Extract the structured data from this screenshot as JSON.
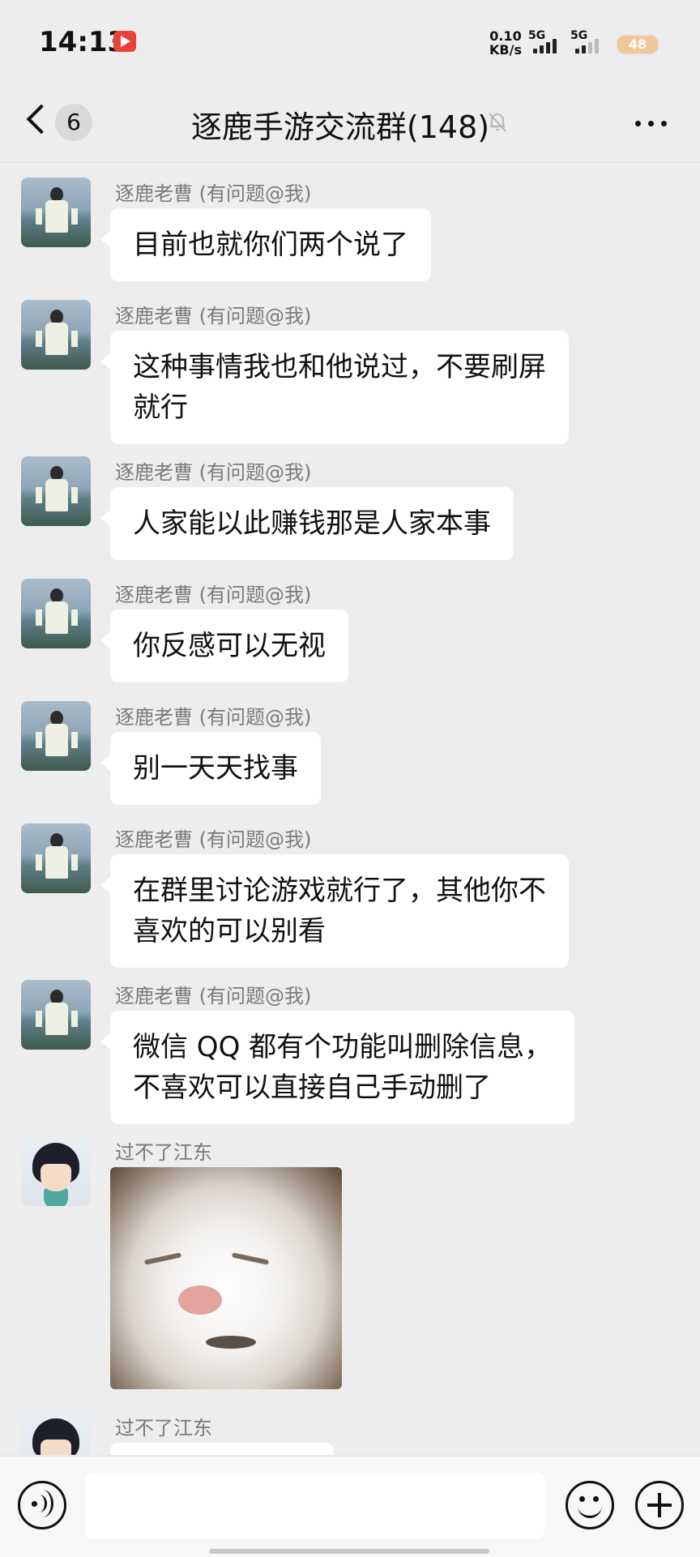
{
  "status_bar": {
    "time": "14:13",
    "net_speed_value": "0.10",
    "net_speed_unit": "KB/s",
    "signal1_label": "5G",
    "signal2_label": "5G",
    "battery": "48",
    "battery_color": "#f0c79a"
  },
  "header": {
    "unread_count": "6",
    "title": "逐鹿手游交流群(148)",
    "muted": true
  },
  "messages": [
    {
      "sender": "逐鹿老曹 (有问题@我)",
      "text": "目前也就你们两个说了",
      "avatar": "man-photo"
    },
    {
      "sender": "逐鹿老曹 (有问题@我)",
      "text": "这种事情我也和他说过，不要刷屏\n就行",
      "avatar": "man-photo"
    },
    {
      "sender": "逐鹿老曹 (有问题@我)",
      "text": "人家能以此赚钱那是人家本事",
      "avatar": "man-photo"
    },
    {
      "sender": "逐鹿老曹 (有问题@我)",
      "text": "你反感可以无视",
      "avatar": "man-photo"
    },
    {
      "sender": "逐鹿老曹 (有问题@我)",
      "text": "别一天天找事",
      "avatar": "man-photo"
    },
    {
      "sender": "逐鹿老曹 (有问题@我)",
      "text": "在群里讨论游戏就行了，其他你不\n喜欢的可以别看",
      "avatar": "man-photo"
    },
    {
      "sender": "逐鹿老曹 (有问题@我)",
      "text": "微信 QQ 都有个功能叫删除信息，\n不喜欢可以直接自己手动删了",
      "avatar": "man-photo"
    },
    {
      "sender": "过不了江东",
      "image": "cat-sticker",
      "avatar": "anime-boy"
    },
    {
      "sender": "过不了江东",
      "text": "",
      "avatar": "anime-boy"
    }
  ],
  "input_bar": {
    "placeholder": "",
    "icons": [
      "voice-icon",
      "emoji-icon",
      "plus-icon"
    ]
  },
  "colors": {
    "background": "#ededed",
    "bubble": "#ffffff",
    "sender_text": "#7a7a7a"
  }
}
